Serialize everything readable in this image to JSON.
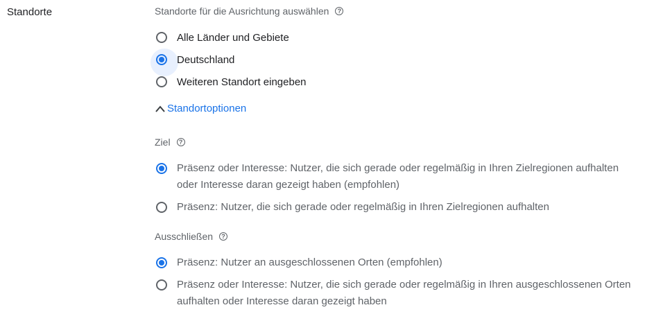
{
  "section": {
    "label": "Standorte"
  },
  "locations": {
    "heading": "Standorte für die Ausrichtung auswählen",
    "options": [
      {
        "label": "Alle Länder und Gebiete",
        "checked": false
      },
      {
        "label": "Deutschland",
        "checked": true
      },
      {
        "label": "Weiteren Standort eingeben",
        "checked": false
      }
    ]
  },
  "location_options_toggle": {
    "label": "Standortoptionen",
    "icon": "chevron-up-icon"
  },
  "target": {
    "heading": "Ziel",
    "options": [
      {
        "label": "Präsenz oder Interesse: Nutzer, die sich gerade oder regelmäßig in Ihren Zielregionen aufhalten oder Interesse daran gezeigt haben (empfohlen)",
        "checked": true
      },
      {
        "label": "Präsenz: Nutzer, die sich gerade oder regelmäßig in Ihren Zielregionen aufhalten",
        "checked": false
      }
    ]
  },
  "exclude": {
    "heading": "Ausschließen",
    "options": [
      {
        "label": "Präsenz: Nutzer an ausgeschlossenen Orten (empfohlen)",
        "checked": true
      },
      {
        "label": "Präsenz oder Interesse: Nutzer, die sich gerade oder regelmäßig in Ihren ausgeschlossenen Orten aufhalten oder Interesse daran gezeigt haben",
        "checked": false
      }
    ]
  },
  "colors": {
    "accent": "#1a73e8",
    "halo": "#e8f0fe",
    "text_primary": "#202124",
    "text_secondary": "#5f6368"
  }
}
